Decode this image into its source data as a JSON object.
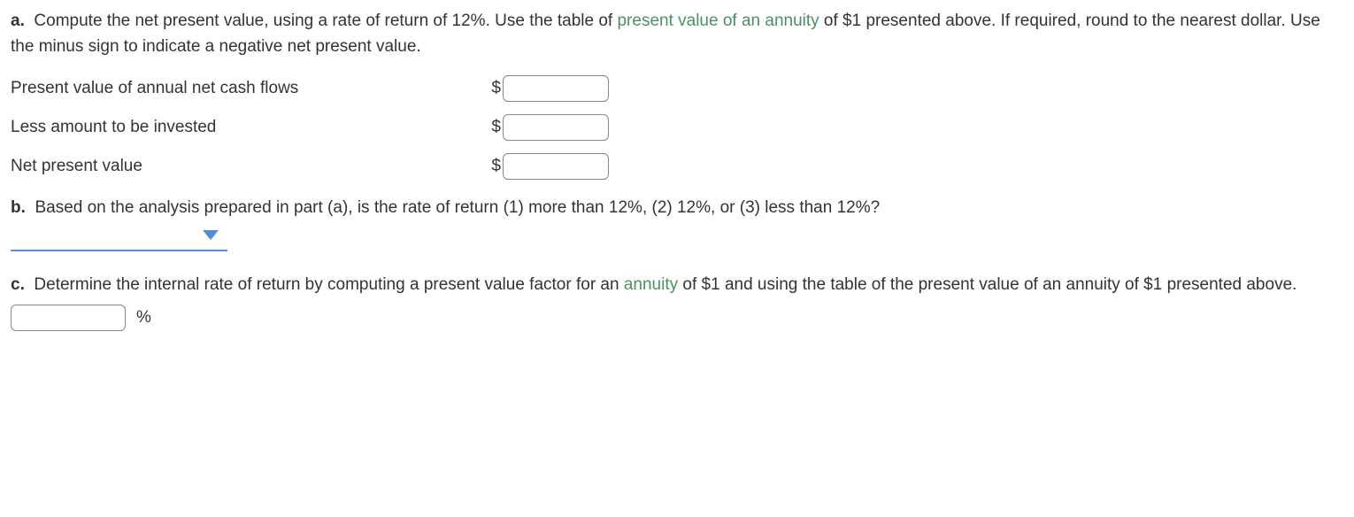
{
  "partA": {
    "label": "a.",
    "text_before_link": "Compute the net present value, using a rate of return of 12%. Use the table of ",
    "link_text": "present value of an annuity",
    "text_after_link": " of $1 presented above. If required, round to the nearest dollar. Use the minus sign to indicate a negative net present value.",
    "rows": [
      {
        "label": "Present value of annual net cash flows",
        "prefix": "$",
        "value": ""
      },
      {
        "label": "Less amount to be invested",
        "prefix": "$",
        "value": ""
      },
      {
        "label": "Net present value",
        "prefix": "$",
        "value": ""
      }
    ]
  },
  "partB": {
    "label": "b.",
    "text": "Based on the analysis prepared in part (a), is the rate of return (1) more than 12%, (2) 12%, or (3) less than 12%?",
    "dropdown_value": ""
  },
  "partC": {
    "label": "c.",
    "text_before_link": "Determine the internal rate of return by computing a present value factor for an ",
    "link_text": "annuity",
    "text_after_link": " of $1 and using the table of the present value of an annuity of $1 presented above.",
    "value": "",
    "suffix": "%"
  }
}
